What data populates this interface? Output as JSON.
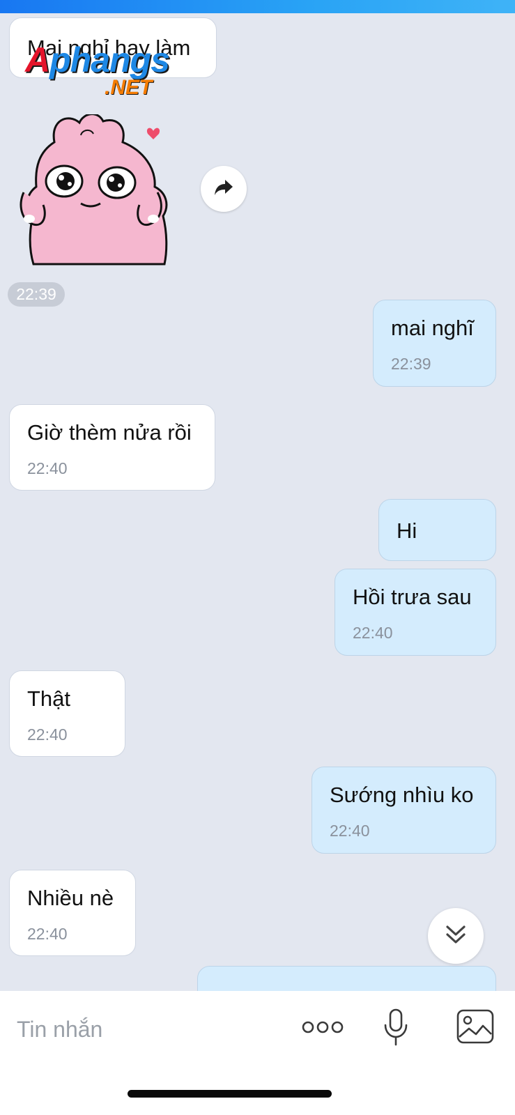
{
  "messages": [
    {
      "dir": "in",
      "text": "Mai nghỉ hay làm"
    },
    {
      "dir": "out",
      "text": "mai nghĩ",
      "time": "22:39"
    },
    {
      "dir": "in",
      "text": "Giờ thèm nửa rồi",
      "time": "22:40"
    },
    {
      "dir": "out",
      "text": "Hi"
    },
    {
      "dir": "out",
      "text": "Hồi trưa sau",
      "time": "22:40"
    },
    {
      "dir": "in",
      "text": "Thật",
      "time": "22:40"
    },
    {
      "dir": "out",
      "text": "Sướng nhìu ko",
      "time": "22:40"
    },
    {
      "dir": "in",
      "text": "Nhiều nè",
      "time": "22:40"
    }
  ],
  "sticker": {
    "name": "pink-bunny-sticker",
    "time": "22:39"
  },
  "watermark": {
    "brand": "Aphangs",
    "suffix": ".NET"
  },
  "composer": {
    "placeholder": "Tin nhắn"
  },
  "icons": {
    "share": "share-arrow-icon",
    "scroll": "double-chevron-down-icon",
    "more": "more-dots-icon",
    "mic": "microphone-icon",
    "image": "image-icon"
  },
  "colors": {
    "incoming": "#ffffff",
    "outgoing": "#d4ecfd",
    "background": "#e3e7f0",
    "accent": "#1877f2"
  }
}
